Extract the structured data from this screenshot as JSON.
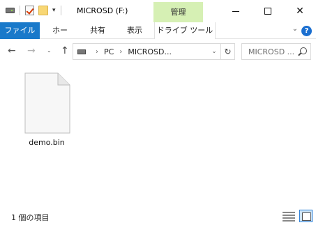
{
  "window": {
    "title": "MICROSD (F:)",
    "context_tab_header": "管理"
  },
  "qat": {
    "icons": [
      "drive-icon",
      "properties-check-icon",
      "new-folder-icon"
    ],
    "dropdown": "▾"
  },
  "titlebar_buttons": {
    "close": "✕"
  },
  "ribbon": {
    "tabs": [
      {
        "label": "ファイル",
        "active": true
      },
      {
        "label": "ホーム"
      },
      {
        "label": "共有"
      },
      {
        "label": "表示"
      },
      {
        "label": "ドライブ ツール"
      }
    ],
    "collapse_chevron": "⌄",
    "help": "?",
    "accent_color": "#1979ca",
    "context_color": "#d6f0b4"
  },
  "navigation": {
    "back": "←",
    "forward": "→",
    "recent": "⌄",
    "up": "↑",
    "address_parts": [
      "PC",
      "MICROSD..."
    ],
    "address_separator": "›",
    "address_dropdown": "⌄",
    "refresh": "↻",
    "search_placeholder": "MICROSD ..."
  },
  "content": {
    "items": [
      {
        "name": "demo.bin",
        "icon": "blank-file-icon"
      }
    ]
  },
  "status": {
    "item_count": "1 個の項目",
    "view_mode": "large-icons"
  }
}
